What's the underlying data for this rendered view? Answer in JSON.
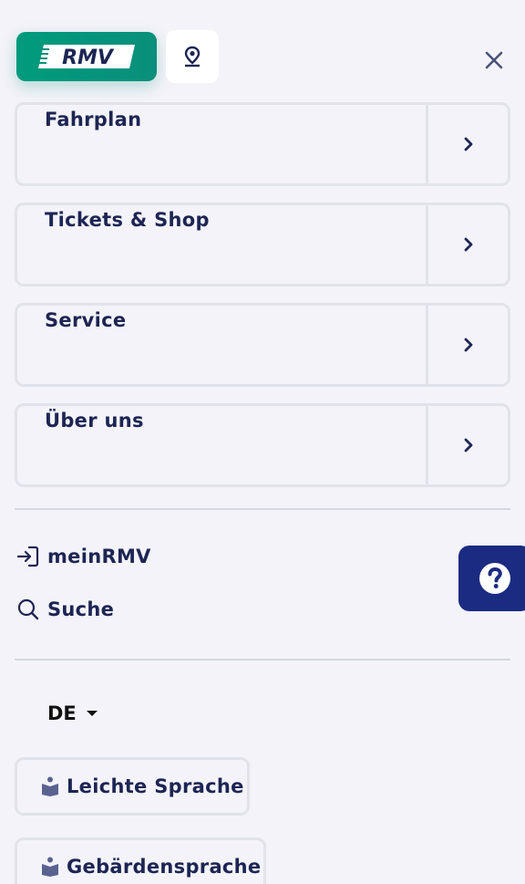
{
  "header": {
    "logo_alt": "RMV",
    "location_icon": "map-pin-icon",
    "close_icon": "close-icon"
  },
  "menu": [
    {
      "label": "Fahrplan"
    },
    {
      "label": "Tickets & Shop"
    },
    {
      "label": "Service"
    },
    {
      "label": "Über uns"
    }
  ],
  "links": {
    "login_label": "meinRMV",
    "search_label": "Suche"
  },
  "language": {
    "selected": "DE"
  },
  "accessibility": {
    "easy_language_label": "Leichte Sprache",
    "sign_language_label": "Gebärdensprache"
  },
  "colors": {
    "brand_green": "#009b7c",
    "navy": "#1d2553",
    "help_button": "#1b2b82"
  }
}
